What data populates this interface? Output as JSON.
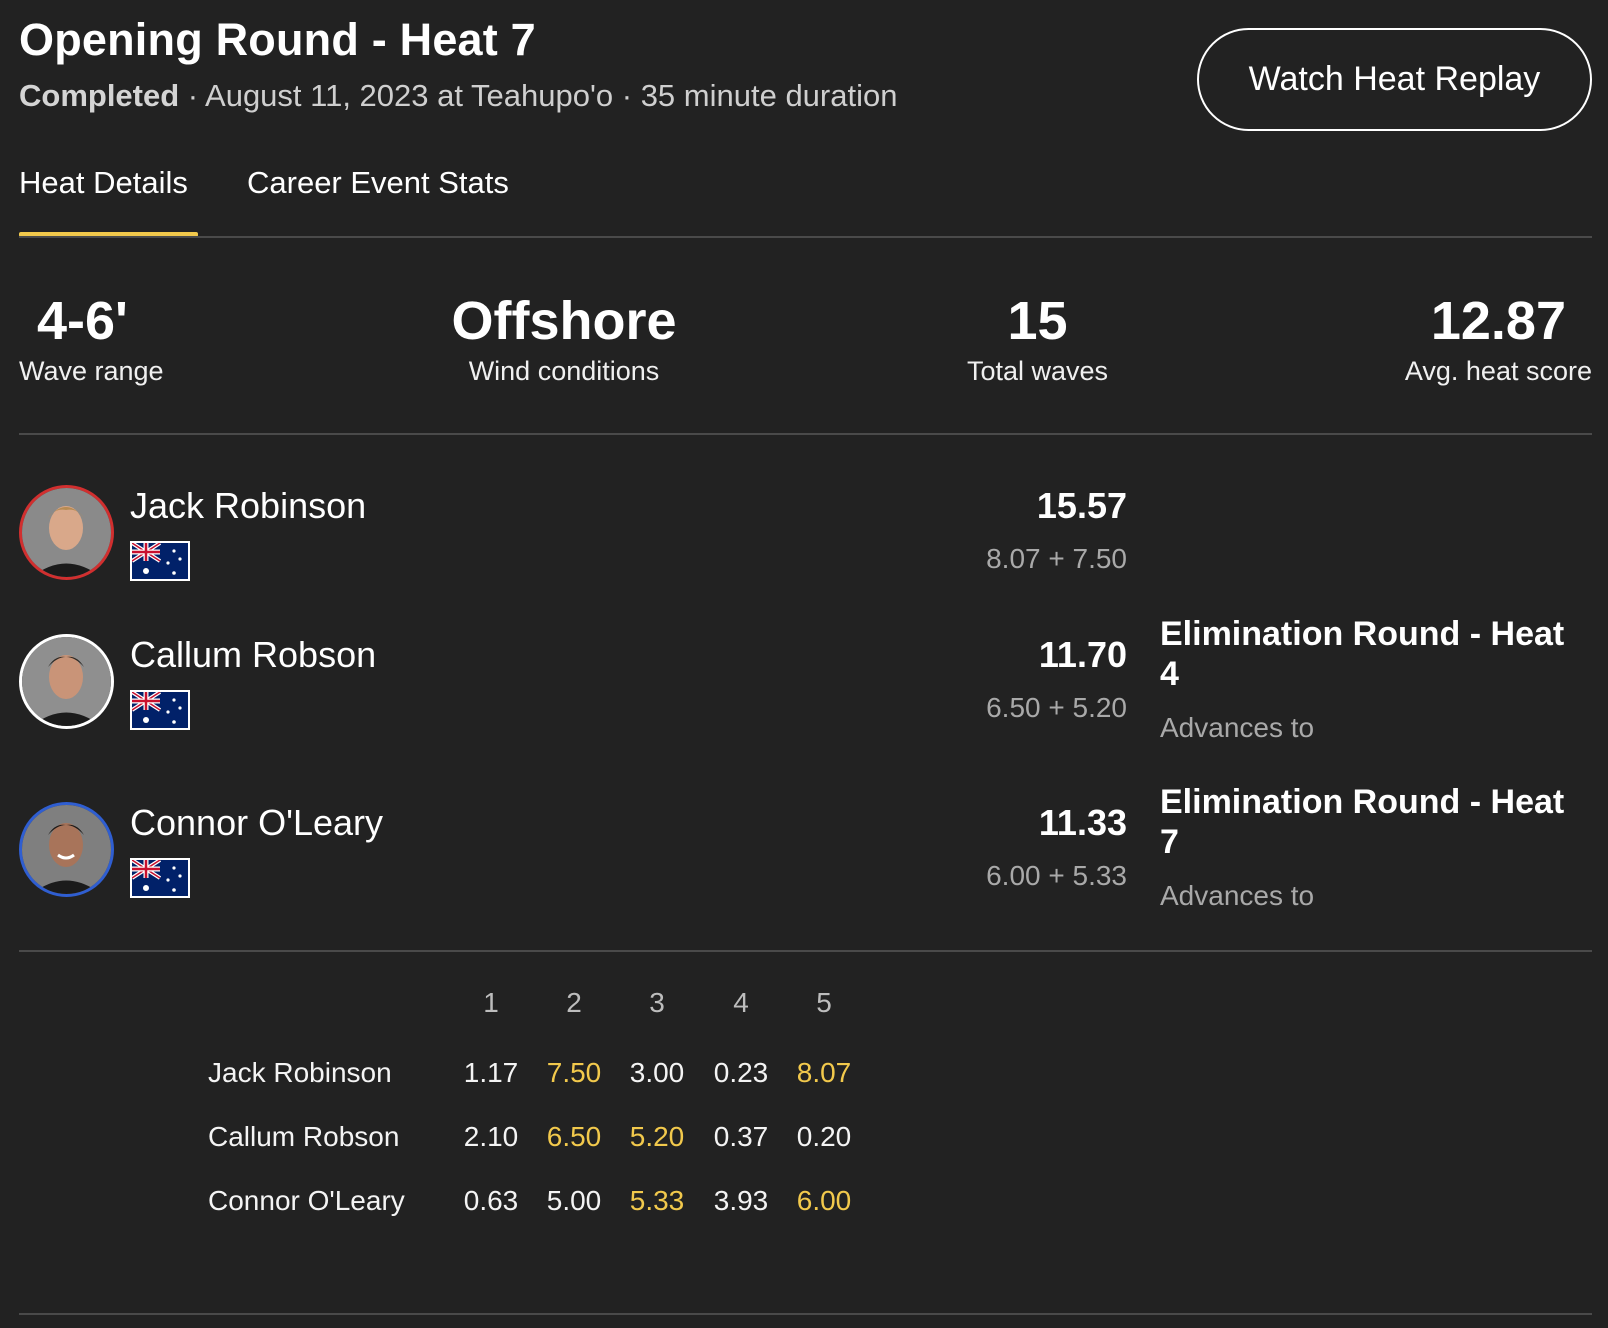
{
  "header": {
    "title": "Opening Round - Heat 7",
    "status": "Completed",
    "details": " · August 11, 2023 at Teahupo'o · 35 minute duration",
    "replay_button": "Watch Heat Replay"
  },
  "tabs": [
    {
      "label": "Heat Details",
      "active": true
    },
    {
      "label": "Career Event Stats",
      "active": false
    }
  ],
  "accent_color": "#f2c94c",
  "stats": [
    {
      "value": "4-6'",
      "label": "Wave range"
    },
    {
      "value": "Offshore",
      "label": "Wind conditions"
    },
    {
      "value": "15",
      "label": "Total waves"
    },
    {
      "value": "12.87",
      "label": "Avg. heat score"
    }
  ],
  "surfers": [
    {
      "name": "Jack Robinson",
      "jersey_color": "#d12f2f",
      "country_flag": "australia-flag",
      "total": "15.57",
      "breakdown": "8.07 + 7.50",
      "advances_to": "",
      "advances_label": ""
    },
    {
      "name": "Callum Robson",
      "jersey_color": "#ffffff",
      "country_flag": "australia-flag",
      "total": "11.70",
      "breakdown": "6.50 + 5.20",
      "advances_to": "Elimination Round - Heat 4",
      "advances_label": "Advances to"
    },
    {
      "name": "Connor O'Leary",
      "jersey_color": "#2f5ed1",
      "country_flag": "australia-flag",
      "total": "11.33",
      "breakdown": "6.00 + 5.33",
      "advances_to": "Elimination Round - Heat 7",
      "advances_label": "Advances to"
    }
  ],
  "wave_table": {
    "columns": [
      "1",
      "2",
      "3",
      "4",
      "5"
    ],
    "rows": [
      {
        "name": "Jack Robinson",
        "scores": [
          "1.17",
          "7.50",
          "3.00",
          "0.23",
          "8.07"
        ],
        "counted": [
          false,
          true,
          false,
          false,
          true
        ]
      },
      {
        "name": "Callum Robson",
        "scores": [
          "2.10",
          "6.50",
          "5.20",
          "0.37",
          "0.20"
        ],
        "counted": [
          false,
          true,
          true,
          false,
          false
        ]
      },
      {
        "name": "Connor O'Leary",
        "scores": [
          "0.63",
          "5.00",
          "5.33",
          "3.93",
          "6.00"
        ],
        "counted": [
          false,
          false,
          true,
          false,
          true
        ]
      }
    ]
  }
}
